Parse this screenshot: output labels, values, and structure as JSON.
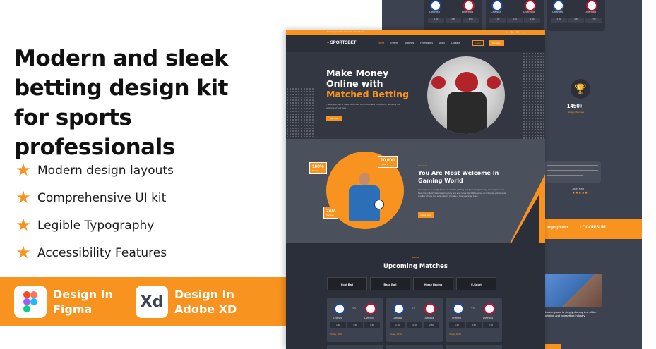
{
  "headline": "Modern and sleek betting design kit for sports professionals",
  "features": [
    "Modern design layouts",
    "Comprehensive UI kit",
    "Legible Typography",
    "Accessibility Features"
  ],
  "tools": [
    {
      "line1": "Design In",
      "line2": "Figma",
      "icon": "figma-logo"
    },
    {
      "line1": "Design In",
      "line2": "Adobe XD",
      "icon": "xd-logo",
      "mark": "Xd"
    }
  ],
  "colors": {
    "accent": "#f7931e",
    "dark": "#2b2f39",
    "panel": "#3d4250"
  },
  "mockup": {
    "topbar_text": "Lorem ipsum dolor sit amet consectetur",
    "brand": "SPORTSBET",
    "menu": [
      "Home",
      "Events",
      "Matches",
      "Promotions",
      "Apps",
      "Contact"
    ],
    "login": "Login",
    "register": "Register",
    "hero": {
      "line1": "Make Money",
      "line2": "Online with",
      "line3": "Matched Betting",
      "sub": "The simple way to make extra cash from bookmaker promotions, no matter the outcome of your bets.",
      "cta": "Join Now"
    },
    "welcome": {
      "tag": "About Us",
      "title1": "You Are Most Welcome In",
      "title2": "Gaming World",
      "text": "Lorem ipsum is simply dummy text of the printing and typesetting industry. Lorem ipsum has been the industry's standard dummy text ever since the 1500s, when an unknown printer took a galley of type and scrambled it to make a type specimen book.",
      "btn": "About More",
      "badges": [
        {
          "num": "100%",
          "label": "Secure"
        },
        {
          "num": "10,000",
          "label": "Players"
        },
        {
          "num": "24/7",
          "label": "Support"
        }
      ]
    },
    "matches": {
      "tag": "Events",
      "title": "Upcoming Matches",
      "tabs": [
        "Foot Ball",
        "Base Ball",
        "Horse Racing",
        "E-Sport"
      ],
      "cards": [
        {
          "home": "Chelsea",
          "away": "Liverpool",
          "odds": [
            "1.30",
            "4.50",
            "2.50"
          ],
          "foot": "Today, 18:00"
        },
        {
          "home": "Chelsea",
          "away": "Liverpool",
          "odds": [
            "1.30",
            "4.50",
            "2.50"
          ],
          "foot": "Today, 18:00"
        },
        {
          "home": "Chelsea",
          "away": "Liverpool",
          "odds": [
            "1.30",
            "4.50",
            "2.50"
          ],
          "foot": "Today, 18:00"
        }
      ]
    }
  },
  "back": {
    "cards": [
      {
        "home": "Chelsea",
        "away": "Liverpool",
        "odds": [
          "1.30",
          "4.50",
          "2.50"
        ]
      },
      {
        "home": "Chelsea",
        "away": "Liverpool",
        "odds": [
          "1.30",
          "4.50",
          "2.50"
        ]
      },
      {
        "home": "Chelsea",
        "away": "Liverpool",
        "odds": [
          "1.30",
          "4.50",
          "2.50"
        ]
      }
    ],
    "stat_num": "1450+",
    "stat_label": "Happy Members",
    "reviewer": "Jhon Ken",
    "partners": [
      "logoipsum",
      "LOGOIPSUM"
    ],
    "blog_title": "Lorem ipsum is simply dummy text of the printing and typesetting industry"
  }
}
